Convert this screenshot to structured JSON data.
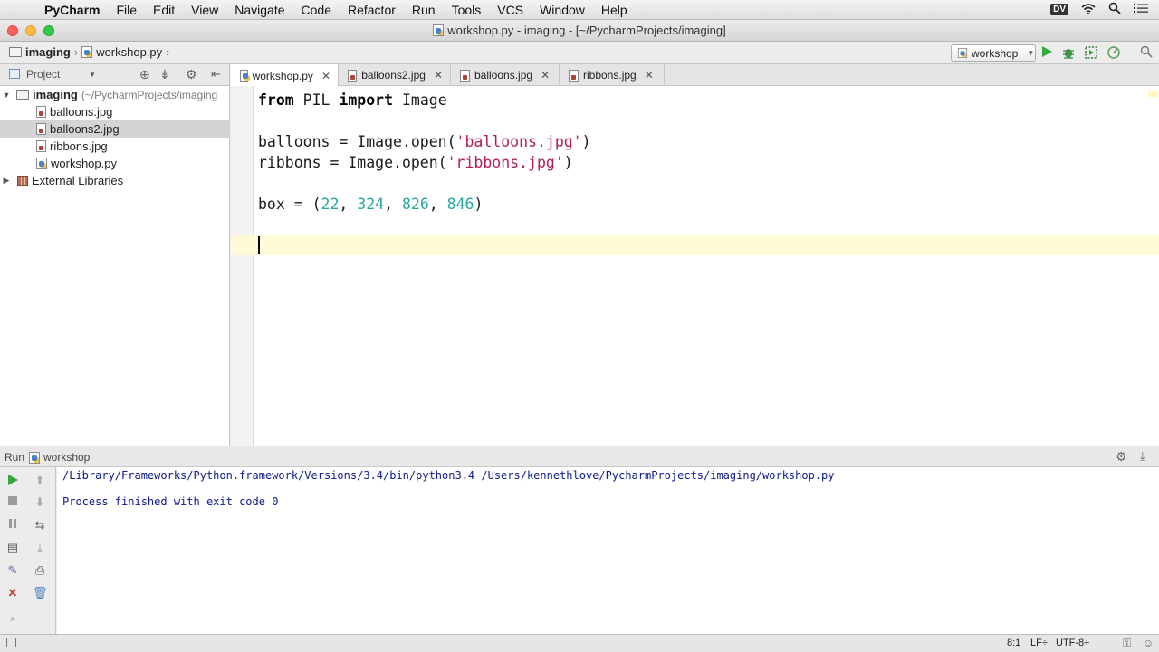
{
  "menubar": {
    "app": "PyCharm",
    "items": [
      "File",
      "Edit",
      "View",
      "Navigate",
      "Code",
      "Refactor",
      "Run",
      "Tools",
      "VCS",
      "Window",
      "Help"
    ],
    "badge": "DV"
  },
  "window": {
    "title": "workshop.py - imaging - [~/PycharmProjects/imaging]"
  },
  "navbar": {
    "breadcrumbs": [
      "imaging",
      "workshop.py"
    ],
    "run_config": "workshop"
  },
  "project": {
    "header": "Project",
    "root": {
      "name": "imaging",
      "path": "(~/PycharmProjects/imaging"
    },
    "files": [
      "balloons.jpg",
      "balloons2.jpg",
      "ribbons.jpg",
      "workshop.py"
    ],
    "external": "External Libraries"
  },
  "tabs": [
    {
      "label": "workshop.py",
      "icon": "python-file-icon",
      "active": true
    },
    {
      "label": "balloons2.jpg",
      "icon": "image-file-icon",
      "active": false
    },
    {
      "label": "balloons.jpg",
      "icon": "image-file-icon",
      "active": false
    },
    {
      "label": "ribbons.jpg",
      "icon": "image-file-icon",
      "active": false
    }
  ],
  "code": {
    "line1": {
      "kw1": "from",
      "mod": " PIL ",
      "kw2": "import",
      "name": " Image"
    },
    "line3": {
      "pre": "balloons = Image.open(",
      "str": "'balloons.jpg'",
      "post": ")"
    },
    "line4": {
      "pre": "ribbons = Image.open(",
      "str": "'ribbons.jpg'",
      "post": ")"
    },
    "line6": {
      "pre": "box = (",
      "n1": "22",
      "n2": "324",
      "n3": "826",
      "n4": "846",
      "sep": ", ",
      "post": ")"
    }
  },
  "run": {
    "label": "Run",
    "config": "workshop",
    "output": [
      "/Library/Frameworks/Python.framework/Versions/3.4/bin/python3.4 /Users/kennethlove/PycharmProjects/imaging/workshop.py",
      "",
      "Process finished with exit code 0"
    ]
  },
  "status": {
    "position": "8:1",
    "line_sep": "LF÷",
    "encoding": "UTF-8÷"
  },
  "colors": {
    "string": "#b21c5a",
    "number": "#2ba4a4",
    "console": "#0c1a8c",
    "current_line": "#fffad8"
  }
}
